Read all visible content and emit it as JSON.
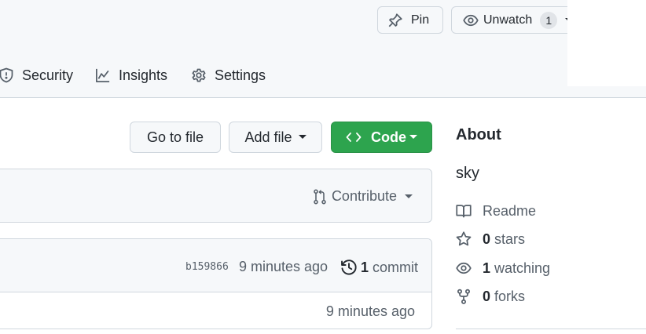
{
  "header": {
    "pin_label": "Pin",
    "watch_label": "Unwatch",
    "watch_count": "1"
  },
  "nav": {
    "items": [
      {
        "label": "Security",
        "icon": "shield-icon"
      },
      {
        "label": "Insights",
        "icon": "graph-icon"
      },
      {
        "label": "Settings",
        "icon": "gear-icon"
      }
    ]
  },
  "toolbar": {
    "goto_file": "Go to file",
    "add_file": "Add file",
    "code": "Code"
  },
  "contribute": {
    "label": "Contribute"
  },
  "latest_commit": {
    "sha": "b159866",
    "time": "9 minutes ago",
    "commit_count": "1",
    "commit_word": "commit"
  },
  "file_row": {
    "time": "9 minutes ago"
  },
  "about": {
    "title": "About",
    "description": "sky",
    "readme": "Readme",
    "stars_count": "0",
    "stars_word": "stars",
    "watching_count": "1",
    "watching_word": "watching",
    "forks_count": "0",
    "forks_word": "forks"
  },
  "colors": {
    "primary_button": "#2da44e",
    "header_bg": "#f6f8fa",
    "border": "#d0d7de",
    "muted_text": "#57606a"
  }
}
